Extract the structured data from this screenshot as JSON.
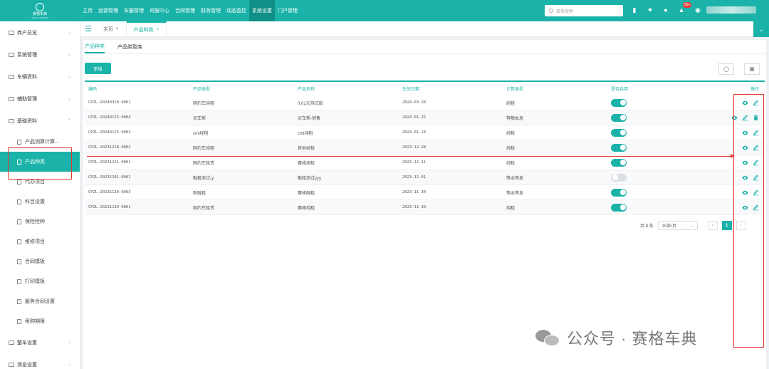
{
  "brand": {
    "name": "赛格车典",
    "sub": "SAIGE CHEDIAN"
  },
  "nav": [
    "主页",
    "运营管理",
    "车服管理",
    "司服中心",
    "合同管理",
    "财务管理",
    "动态监控",
    "系统设置",
    "门户管理"
  ],
  "nav_active_index": 7,
  "search": {
    "placeholder": "菜单搜索"
  },
  "notification_badge": "99+",
  "sidebar": {
    "groups_top": [
      "商户总览",
      "系统管理",
      "车辆资料",
      "辅助管理",
      "基础资料"
    ],
    "items": [
      "产品测算计算...",
      "产品种类",
      "代办项目",
      "科目设置",
      "保险险种",
      "维修项目",
      "合同模板",
      "打印模板",
      "服务合同设置",
      "租购期限"
    ],
    "active_item_index": 1,
    "groups_bottom": [
      "整车设置",
      "消息设置"
    ]
  },
  "tabs": [
    {
      "label": "主页",
      "close": "×"
    },
    {
      "label": "产品种类",
      "close": "×"
    }
  ],
  "subtabs": [
    "产品种类",
    "产品类型库"
  ],
  "add_button": "新增",
  "table": {
    "headers": [
      "编码",
      "产品类型",
      "产品名称",
      "生效日期",
      "计算类型",
      "是否启用",
      "操作"
    ],
    "rows": [
      {
        "code": "CPZL-20240328-0001",
        "type": "网约车纯租",
        "name": "0.01元测试版",
        "date": "2024-03-28",
        "calc": "纯租",
        "enabled": true,
        "ops": [
          "view",
          "edit"
        ]
      },
      {
        "code": "CPZL-20240125-0004",
        "type": "买车帮",
        "name": "买车帮-销售",
        "date": "2024-01-25",
        "calc": "等额本息",
        "enabled": true,
        "ops": [
          "view",
          "edit",
          "delete"
        ]
      },
      {
        "code": "CPZL-20240125-0002",
        "type": "cml经租",
        "name": "cml纯租",
        "date": "2024-01-24",
        "calc": "纯租",
        "enabled": true,
        "ops": [
          "view",
          "edit"
        ]
      },
      {
        "code": "CPZL-20231228-0002",
        "type": "网约车纯租",
        "name": "其他经租",
        "date": "2023-12-28",
        "calc": "纯租",
        "enabled": true,
        "ops": [
          "view",
          "edit"
        ]
      },
      {
        "code": "CPZL-20231211-0001",
        "type": "网约车租赁",
        "name": "赛格周租",
        "date": "2023-12-11",
        "calc": "纯租",
        "enabled": true,
        "ops": [
          "view",
          "edit"
        ]
      },
      {
        "code": "CPZL-20231201-0001",
        "type": "融租测试-y",
        "name": "融租测试yyy",
        "date": "2023-12-01",
        "calc": "等本等息",
        "enabled": false,
        "ops": [
          "view",
          "edit"
        ]
      },
      {
        "code": "CPZL-20231130-0003",
        "type": "新融租",
        "name": "赛格融租",
        "date": "2023-11-30",
        "calc": "等本等息",
        "enabled": true,
        "ops": [
          "view",
          "edit"
        ]
      },
      {
        "code": "CPZL-20231130-0001",
        "type": "网约车租赁",
        "name": "赛格纯租",
        "date": "2023-11-30",
        "calc": "纯租",
        "enabled": true,
        "ops": [
          "view",
          "edit"
        ]
      }
    ]
  },
  "pager": {
    "total": "共 8 条",
    "size": "15条/页",
    "prev": "‹",
    "current": "1",
    "next": "›"
  },
  "watermark": "公众号 · 赛格车典"
}
